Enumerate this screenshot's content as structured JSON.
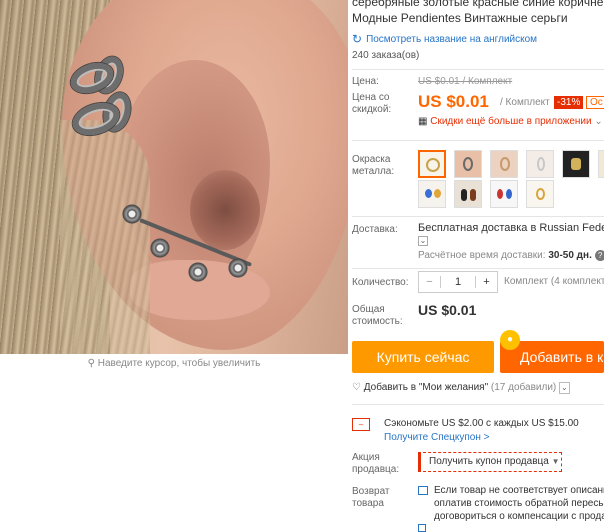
{
  "image": {
    "zoom_hint": "Наведите курсор, чтобы увеличить"
  },
  "product": {
    "title_line1": "серебряные золотые красные синие коричне",
    "title_line2": "Модные Pendientes Винтажные серьги",
    "translate_link": "Посмотреть название на английском",
    "orders": "240 заказа(ов)"
  },
  "price": {
    "label": "Цена:",
    "old": "US $0.01 / Комплект",
    "discount_label": "Цена со скидкой:",
    "current": "US $0.01",
    "unit": "/ Комплект",
    "discount_badge": "-31%",
    "extra_badge": "Ос",
    "app_promo": "Скидки ещё больше в приложении"
  },
  "color": {
    "label": "Окраска металла:"
  },
  "shipping": {
    "label": "Доставка:",
    "value": "Бесплатная доставка в Russian Federat",
    "time_label": "Расчётное время доставки:",
    "time_value": "30-50 дн."
  },
  "quantity": {
    "label": "Количество:",
    "minus": "−",
    "value": "1",
    "plus": "+",
    "available": "Комплект (4 комплекта"
  },
  "total": {
    "label": "Общая стоимость:",
    "value": "US $0.01"
  },
  "actions": {
    "buy_now": "Купить сейчас",
    "add_to_cart": "Добавить в ко"
  },
  "wishlist": {
    "label": "Добавить в \"Мои желания\"",
    "count": "(17 добавили)"
  },
  "coupon": {
    "text": "Сэкономьте US $2.00 с каждых US $15.00",
    "link": "Получите Спецкупон >"
  },
  "seller_promo": {
    "label": "Акция продавца:",
    "button": "Получить купон продавца"
  },
  "returns": {
    "label": "Возврат товара",
    "line1": "Если товар не соответствует описани",
    "line2": "оплатив стоимость обратной пересы",
    "line3": "договориться о компенсации с прода"
  },
  "colors": {
    "accent_orange": "#ff6600",
    "buy_button": "#ff9900",
    "link_blue": "#2775c6",
    "badge_red": "#e62e04"
  }
}
